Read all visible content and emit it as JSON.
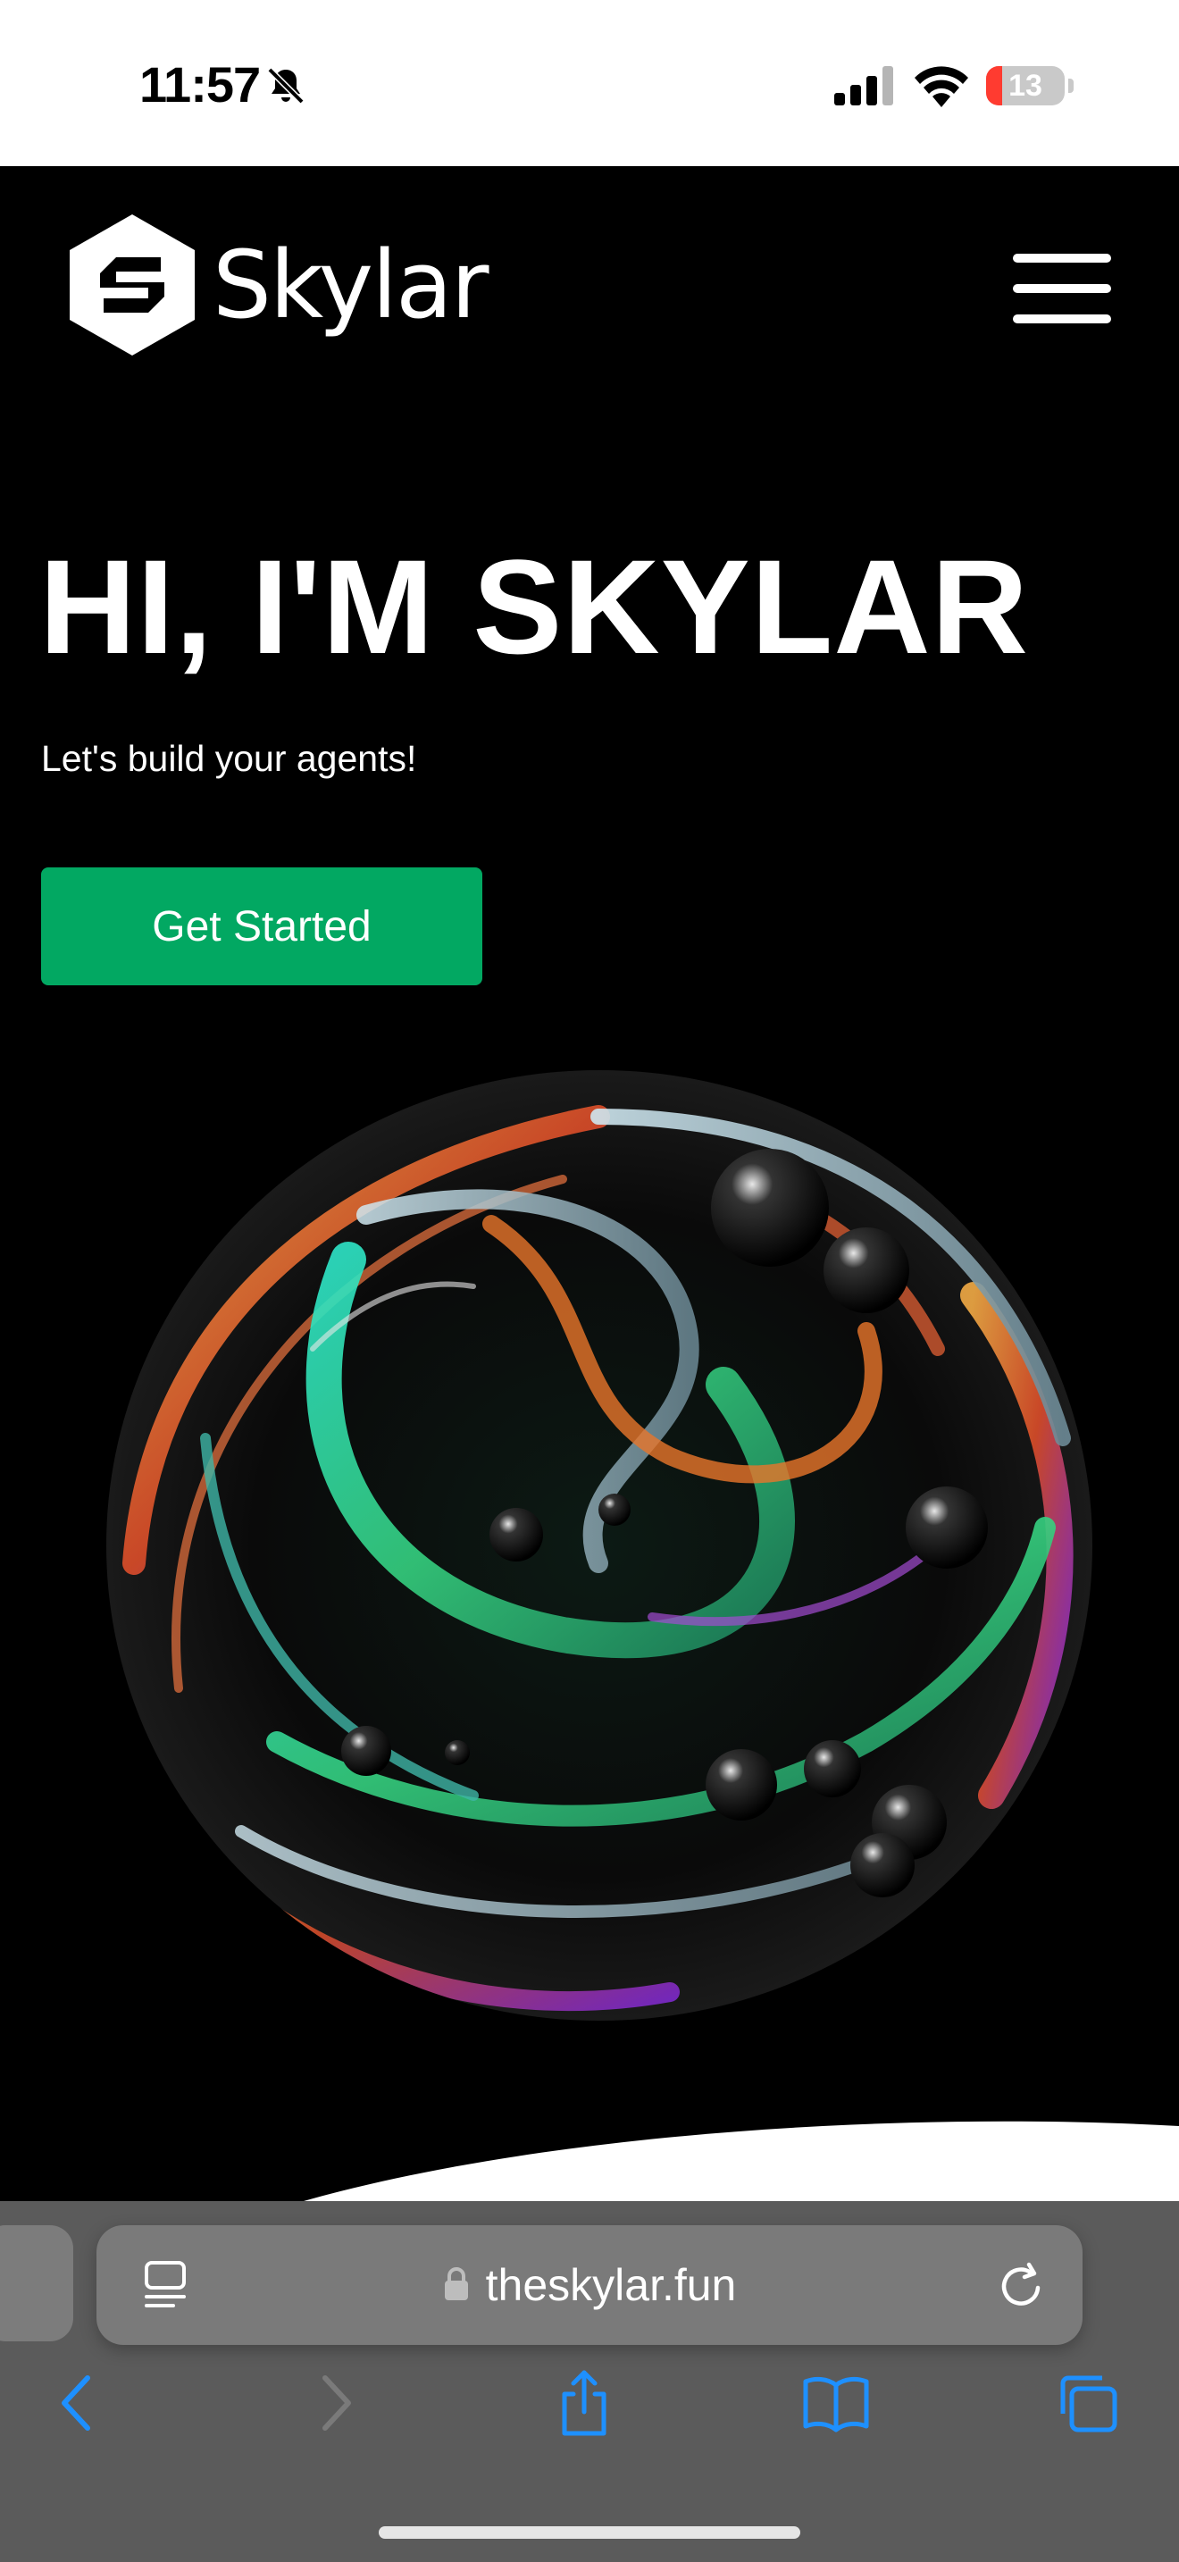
{
  "status_bar": {
    "time": "11:57",
    "battery_level": "13",
    "battery_fraction": 0.13,
    "icons": [
      "bell-slash-icon",
      "cellular-signal-icon",
      "wifi-icon",
      "battery-icon"
    ]
  },
  "header": {
    "brand_name": "Skylar",
    "logo_icon": "skylar-hexagon-s-logo",
    "menu_icon": "hamburger-menu-icon"
  },
  "hero": {
    "title": "HI, I'M SKYLAR",
    "subtitle": "Let's build your agents!",
    "cta_label": "Get Started",
    "cta_color": "#02a862",
    "image": "iridescent-swirl-orb"
  },
  "browser": {
    "url": "theskylar.fun",
    "icons": [
      "reader-icon",
      "lock-icon",
      "reload-icon",
      "back-icon",
      "forward-icon",
      "share-icon",
      "bookmarks-icon",
      "tabs-icon"
    ],
    "accent": "#1e90ff"
  }
}
